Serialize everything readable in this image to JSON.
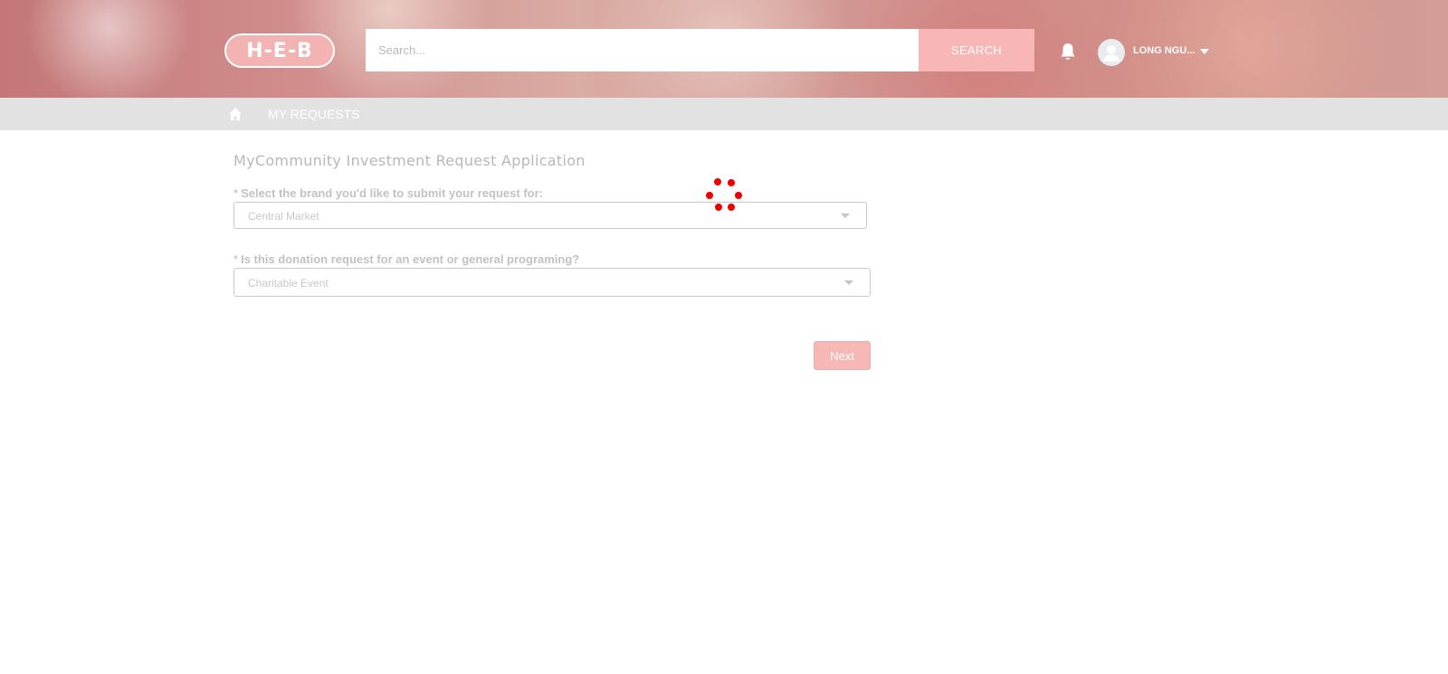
{
  "header": {
    "logo_text": "H-E-B",
    "search": {
      "placeholder": "Search...",
      "value": ""
    },
    "search_button_label": "SEARCH",
    "notifications_icon": "bell-icon",
    "user": {
      "avatar_icon": "user-avatar-icon",
      "name": "LONG NGU...",
      "menu_icon": "caret-down-icon"
    }
  },
  "nav": {
    "home_icon": "home-icon",
    "items": [
      {
        "label": "MY REQUESTS"
      }
    ]
  },
  "form": {
    "title": "MyCommunity Investment Request Application",
    "fields": [
      {
        "required_marker": "*",
        "label": "Select the brand you'd like to submit your request for:",
        "value": "Central Market"
      },
      {
        "required_marker": "*",
        "label": "Is this donation request for an event or general programing?",
        "value": "Charitable Event"
      }
    ],
    "next_label": "Next"
  },
  "loading": {
    "icon": "spinner-icon",
    "color": "#ee0000"
  },
  "colors": {
    "brand": "#ee0000",
    "accent_light": "#f8b6b6"
  }
}
